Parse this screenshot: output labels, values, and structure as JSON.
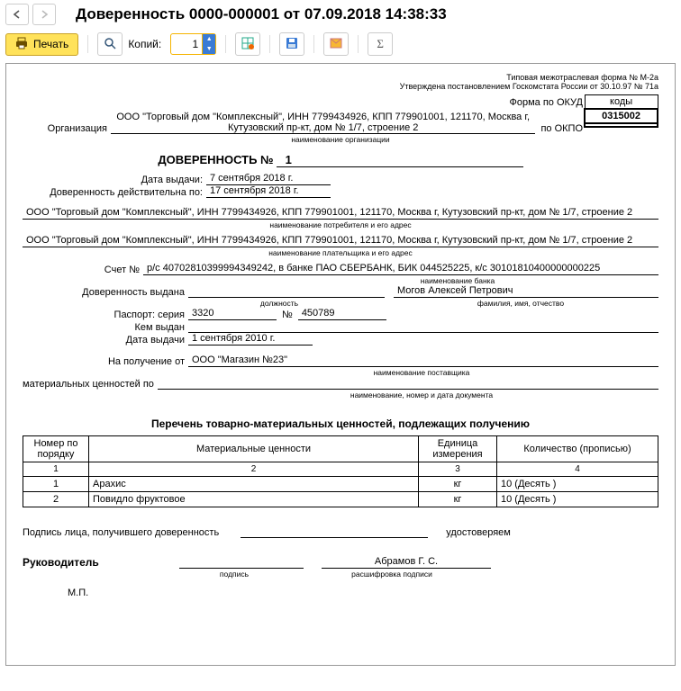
{
  "toolbar": {
    "title": "Доверенность 0000-000001 от 07.09.2018 14:38:33",
    "print_label": "Печать",
    "copies_label": "Копий:",
    "copies_value": "1"
  },
  "header": {
    "form_type": "Типовая межотраслевая форма № М-2а",
    "approved": "Утверждена постановлением Госкомстата России от 30.10.97 № 71а",
    "codes_label": "коды",
    "okud_label": "Форма по ОКУД",
    "okud_code": "0315002",
    "okpo_label": "по ОКПО",
    "okpo_code": " ",
    "org_label": "Организация",
    "org_value": "ООО \"Торговый дом \"Комплексный\", ИНН 7799434926, КПП 779901001, 121170, Москва г, Кутузовский пр-кт, дом № 1/7, строение 2",
    "org_caption": "наименование организации"
  },
  "doc": {
    "title_prefix": "ДОВЕРЕННОСТЬ №",
    "number": "1",
    "issue_date_label": "Дата выдачи:",
    "issue_date": "7 сентября 2018 г.",
    "valid_label": "Доверенность действительна по:",
    "valid_until": "17 сентября 2018 г.",
    "consumer": "ООО \"Торговый дом \"Комплексный\", ИНН 7799434926, КПП 779901001, 121170, Москва г, Кутузовский пр-кт, дом № 1/7, строение 2",
    "consumer_caption": "наименование потребителя и его адрес",
    "payer": "ООО \"Торговый дом \"Комплексный\", ИНН 7799434926, КПП 779901001, 121170, Москва г, Кутузовский пр-кт, дом № 1/7, строение 2",
    "payer_caption": "наименование плательщика и его адрес",
    "account_label": "Счет №",
    "account_value": "р/с 40702810399994349242, в банке ПАО СБЕРБАНК, БИК 044525225, к/с 30101810400000000225",
    "bank_caption": "наименование банка",
    "issued_to_label": "Доверенность выдана",
    "issued_position": "",
    "position_caption": "должность",
    "issued_fio": "Могов Алексей Петрович",
    "fio_caption": "фамилия, имя, отчество",
    "passport_series_label": "Паспорт: серия",
    "passport_series": "3320",
    "passport_no_label": "№",
    "passport_no": "450789",
    "issued_by_label": "Кем выдан",
    "issued_by": "",
    "pass_date_label": "Дата выдачи",
    "pass_date": "1 сентября 2010 г.",
    "receive_from_label": "На получение от",
    "receive_from": "ООО \"Магазин №23\"",
    "supplier_caption": "наименование поставщика",
    "values_by_label": "материальных ценностей по",
    "values_by": "",
    "values_caption": "наименование, номер и дата документа"
  },
  "table": {
    "caption": "Перечень товарно-материальных ценностей, подлежащих получению",
    "headers": [
      "Номер по порядку",
      "Материальные ценности",
      "Единица измерения",
      "Количество (прописью)"
    ],
    "colnums": [
      "1",
      "2",
      "3",
      "4"
    ],
    "rows": [
      {
        "n": "1",
        "name": "Арахис",
        "unit": "кг",
        "qty": "10 (Десять )"
      },
      {
        "n": "2",
        "name": "Повидло фруктовое",
        "unit": "кг",
        "qty": "10 (Десять )"
      }
    ]
  },
  "footer": {
    "sign_holder_label": "Подпись лица, получившего доверенность",
    "certify_label": "удостоверяем",
    "director_label": "Руководитель",
    "sign_caption": "подпись",
    "director_name": "Абрамов Г. С.",
    "decrypt_caption": "расшифровка подписи",
    "stamp_label": "М.П."
  }
}
